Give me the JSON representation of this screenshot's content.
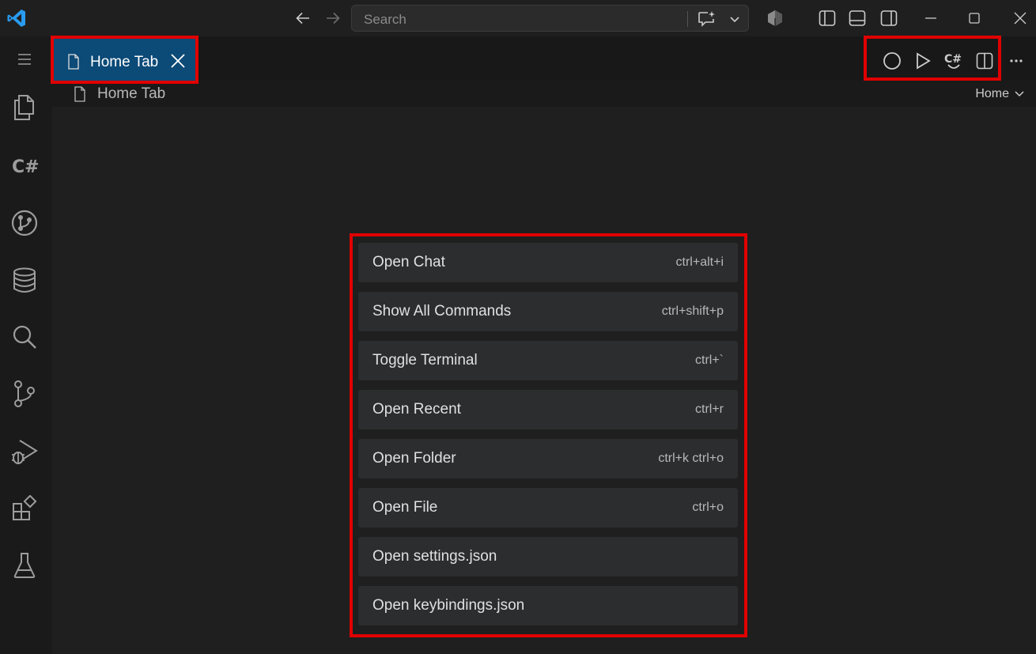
{
  "titlebar": {
    "search_placeholder": "Search"
  },
  "tab": {
    "label": "Home Tab"
  },
  "breadcrumb": {
    "label": "Home Tab",
    "right_label": "Home"
  },
  "editor_actions": [
    "circle-icon",
    "run-icon",
    "csharp-icon",
    "split-editor-icon",
    "more-icon"
  ],
  "activity_icons": [
    "menu-icon",
    "explorer-icon",
    "csharp-icon",
    "git-graph-icon",
    "database-icon",
    "search-icon",
    "source-control-icon",
    "run-debug-icon",
    "extensions-icon",
    "testing-icon"
  ],
  "commands": [
    {
      "label": "Open Chat",
      "key": "ctrl+alt+i"
    },
    {
      "label": "Show All Commands",
      "key": "ctrl+shift+p"
    },
    {
      "label": "Toggle Terminal",
      "key": "ctrl+`"
    },
    {
      "label": "Open Recent",
      "key": "ctrl+r"
    },
    {
      "label": "Open Folder",
      "key": "ctrl+k ctrl+o"
    },
    {
      "label": "Open File",
      "key": "ctrl+o"
    },
    {
      "label": "Open settings.json",
      "key": ""
    },
    {
      "label": "Open keybindings.json",
      "key": ""
    }
  ],
  "colors": {
    "accent_tab": "#0c4a77",
    "highlight": "#e00000",
    "logo": "#2a9bf0"
  }
}
